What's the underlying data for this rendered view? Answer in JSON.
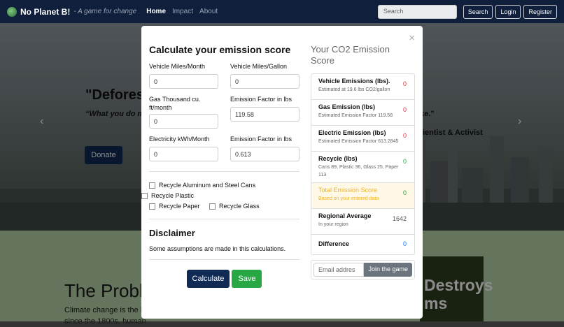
{
  "navbar": {
    "brand": "No Planet B!",
    "tagline": "- A game for change",
    "links": [
      "Home",
      "Impact",
      "About"
    ],
    "search_placeholder": "Search",
    "search_button": "Search",
    "login_button": "Login",
    "register_button": "Register"
  },
  "hero": {
    "title": "\"Defores",
    "quote": "“What you do m",
    "quote_end": "ke.”",
    "attribution": "ientist & Activist",
    "donate_button": "Donate"
  },
  "lower": {
    "problem_title": "The Probl",
    "problem_text": "Climate change is the l patterns. These shifts should occur naturally, but since the 1800s, human",
    "book_text": "Destroys ms"
  },
  "modal": {
    "title": "Calculate your emission score",
    "close": "×",
    "fields": [
      {
        "label": "Vehicle Miles/Month",
        "value": "0"
      },
      {
        "label": "Vehicle Miles/Gallon",
        "value": "0"
      },
      {
        "label": "Gas Thousand cu. ft/month",
        "value": "0"
      },
      {
        "label": "Emission Factor in lbs",
        "value": "119.58"
      },
      {
        "label": "Electricity kWh/Month",
        "value": "0"
      },
      {
        "label": "Emission Factor in lbs",
        "value": "0.613"
      }
    ],
    "checks": [
      "Recycle Aluminum and Steel Cans",
      "Recycle Plastic",
      "Recycle Paper",
      "Recycle Glass"
    ],
    "disclaimer_title": "Disclaimer",
    "disclaimer_text": "Some assumptions are made in this calculations.",
    "calculate_button": "Calculate",
    "save_button": "Save",
    "score_title": "Your CO2 Emission Score",
    "scores": [
      {
        "label": "Vehicle Emissions (lbs).",
        "sub": "Estimated at 19.6 lbs CO2/gallon",
        "value": "0",
        "color": "#dc3545"
      },
      {
        "label": "Gas Emission (lbs)",
        "sub": "Estimated Emission Factor 119.58",
        "value": "0",
        "color": "#dc3545"
      },
      {
        "label": "Electric Emission (lbs)",
        "sub": "Estimated Emission Factor 613.2845",
        "value": "0",
        "color": "#dc3545"
      },
      {
        "label": "Recycle (lbs)",
        "sub": "Cans 89, Plastic 36, Glass 25, Paper 113",
        "value": "0",
        "color": "#28a745"
      },
      {
        "label": "Total Emission Score",
        "sub": "Based on your entered data",
        "value": "0",
        "color": "#28a745"
      },
      {
        "label": "Regional Average",
        "sub": "In your region",
        "value": "1642",
        "color": "#555555"
      },
      {
        "label": "Difference",
        "sub": "",
        "value": "0",
        "color": "#007bff"
      }
    ],
    "email_placeholder": "Email addres",
    "join_button": "Join the game"
  }
}
